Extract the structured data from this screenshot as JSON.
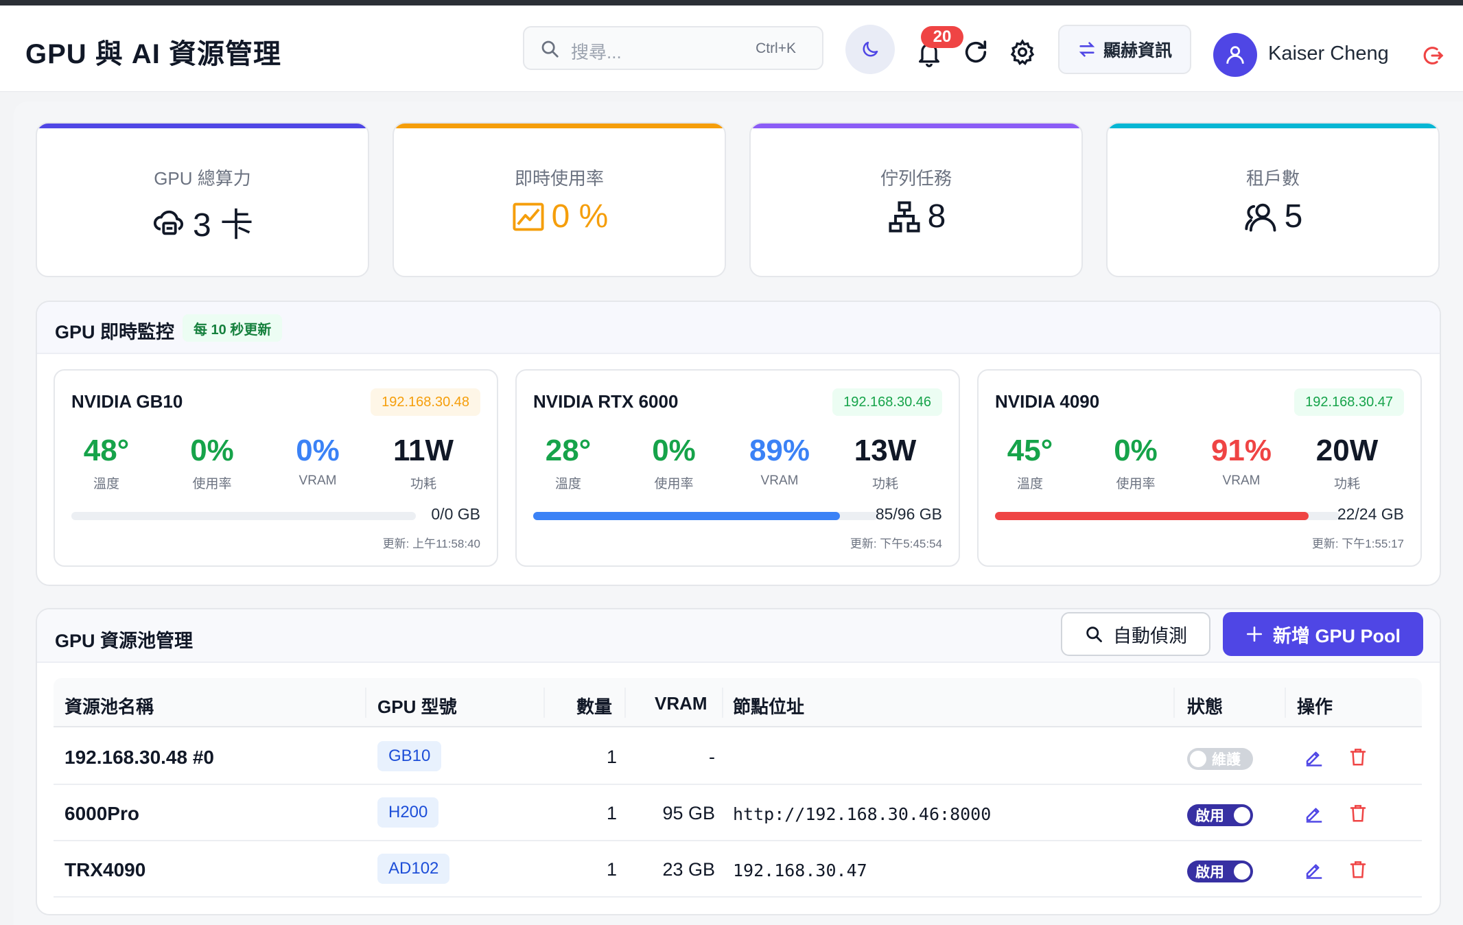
{
  "header": {
    "title": "GPU 與 AI 資源管理",
    "search_placeholder": "搜尋...",
    "search_shortcut": "Ctrl+K",
    "notification_count": "20",
    "info_button": "顯赫資訊",
    "user_name": "Kaiser Cheng"
  },
  "stats": [
    {
      "label": "GPU 總算力",
      "value": "3 卡",
      "icon": "gpu-cloud-icon",
      "accent": "#4f46e5"
    },
    {
      "label": "即時使用率",
      "value": "0 %",
      "icon": "chart-line-icon",
      "accent": "#f59e0b"
    },
    {
      "label": "佇列任務",
      "value": "8",
      "icon": "hierarchy-icon",
      "accent": "#8b5cf6"
    },
    {
      "label": "租戶數",
      "value": "5",
      "icon": "users-icon",
      "accent": "#06b6d4"
    }
  ],
  "monitor": {
    "title": "GPU 即時監控",
    "badge": "每 10 秒更新",
    "metric_labels": {
      "temp": "溫度",
      "usage": "使用率",
      "vram": "VRAM",
      "power": "功耗"
    },
    "gpus": [
      {
        "name": "NVIDIA GB10",
        "ip": "192.168.30.48",
        "ip_color": "#f59e0b",
        "ip_bg": "#fef6e7",
        "temp": "48°",
        "usage": "0%",
        "vram": "0%",
        "vram_color": "#3b82f6",
        "power": "11W",
        "bar_fraction": 0,
        "bar_color": "#3b82f6",
        "bar_text": "0/0 GB",
        "updated": "更新: 上午11:58:40"
      },
      {
        "name": "NVIDIA RTX 6000",
        "ip": "192.168.30.46",
        "ip_color": "#16a34a",
        "ip_bg": "#ecfdf3",
        "temp": "28°",
        "usage": "0%",
        "vram": "89%",
        "vram_color": "#3b82f6",
        "power": "13W",
        "bar_fraction": 0.89,
        "bar_color": "#3b82f6",
        "bar_text": "85/96 GB",
        "updated": "更新: 下午5:45:54"
      },
      {
        "name": "NVIDIA 4090",
        "ip": "192.168.30.47",
        "ip_color": "#16a34a",
        "ip_bg": "#ecfdf3",
        "temp": "45°",
        "usage": "0%",
        "vram": "91%",
        "vram_color": "#ef4444",
        "power": "20W",
        "bar_fraction": 0.91,
        "bar_color": "#ef4444",
        "bar_text": "22/24 GB",
        "updated": "更新: 下午1:55:17"
      }
    ]
  },
  "pool": {
    "title": "GPU 資源池管理",
    "auto_detect": "自動偵測",
    "add_pool": "新增 GPU Pool",
    "columns": [
      "資源池名稱",
      "GPU 型號",
      "數量",
      "VRAM",
      "節點位址",
      "狀態",
      "操作"
    ],
    "rows": [
      {
        "name": "192.168.30.48 #0",
        "model": "GB10",
        "count": "1",
        "vram": "-",
        "address": "",
        "status": "維護",
        "enabled": false
      },
      {
        "name": "6000Pro",
        "model": "H200",
        "count": "1",
        "vram": "95 GB",
        "address": "http://192.168.30.46:8000",
        "status": "啟用",
        "enabled": true
      },
      {
        "name": "TRX4090",
        "model": "AD102",
        "count": "1",
        "vram": "23 GB",
        "address": "192.168.30.47",
        "status": "啟用",
        "enabled": true
      }
    ]
  }
}
